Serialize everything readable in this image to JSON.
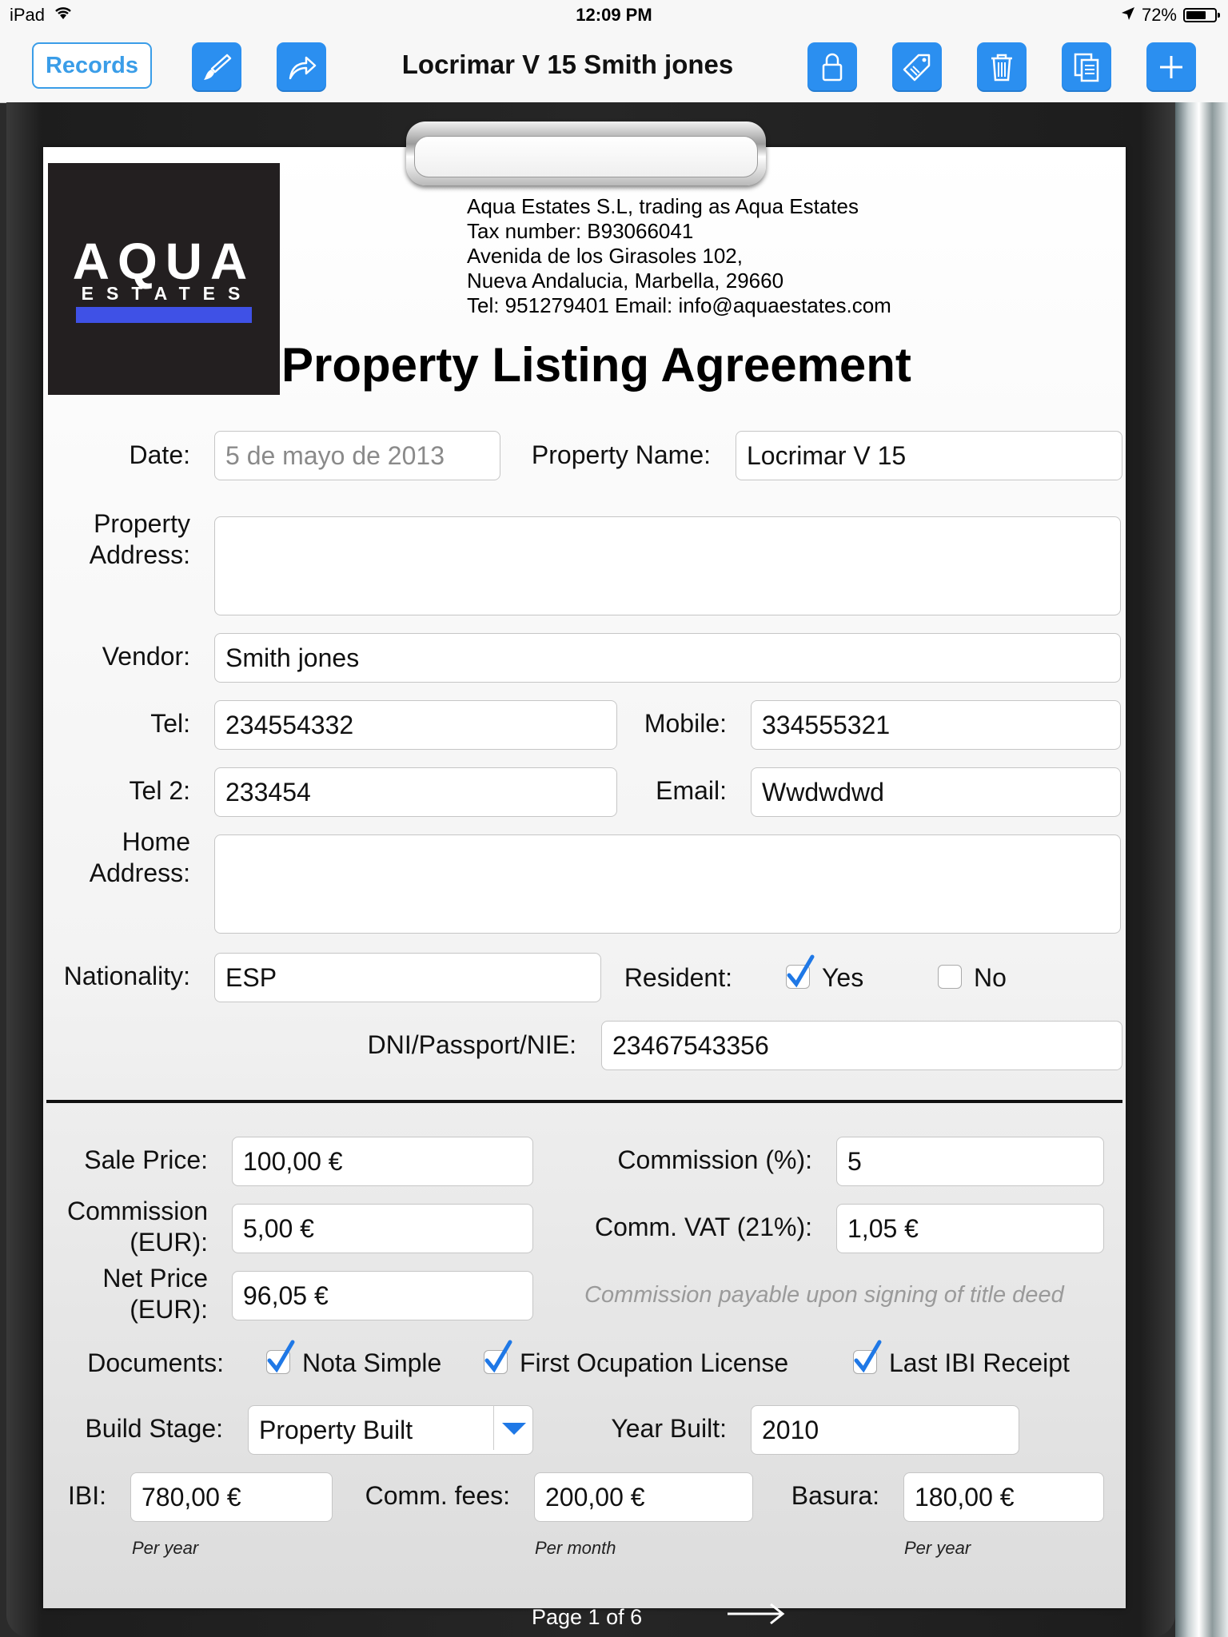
{
  "status_bar": {
    "device": "iPad",
    "time": "12:09 PM",
    "battery": "72%",
    "battery_level": 0.72
  },
  "toolbar": {
    "records_label": "Records",
    "title": "Locrimar V 15 Smith jones",
    "icons": [
      "brush-icon",
      "share-icon",
      "lock-icon",
      "tag-icon",
      "trash-icon",
      "copy-icon",
      "plus-icon"
    ]
  },
  "header": {
    "logo_line1": "AQUA",
    "logo_line2": "ESTATES",
    "logo_bar_color": "#3f51e6",
    "company_lines": [
      "Aqua Estates S.L, trading as Aqua Estates",
      "Tax number: B93066041",
      "Avenida de los Girasoles 102,",
      "Nueva Andalucia, Marbella, 29660",
      "Tel: 951279401 Email: info@aquaestates.com"
    ],
    "title": "Property Listing Agreement"
  },
  "form": {
    "date": {
      "label": "Date:",
      "value": "5 de mayo de 2013"
    },
    "property_name": {
      "label": "Property Name:",
      "value": "Locrimar V 15"
    },
    "property_address": {
      "label_1": "Property",
      "label_2": "Address:",
      "value": ""
    },
    "vendor": {
      "label": "Vendor:",
      "value": "Smith jones"
    },
    "tel": {
      "label": "Tel:",
      "value": "234554332"
    },
    "mobile": {
      "label": "Mobile:",
      "value": "334555321"
    },
    "tel2": {
      "label": "Tel 2:",
      "value": "233454"
    },
    "email": {
      "label": "Email:",
      "value": "Wwdwdwd"
    },
    "home_address": {
      "label_1": "Home",
      "label_2": "Address:",
      "value": ""
    },
    "nationality": {
      "label": "Nationality:",
      "value": "ESP"
    },
    "resident": {
      "label": "Resident:",
      "yes_label": "Yes",
      "no_label": "No",
      "yes_checked": true,
      "no_checked": false
    },
    "dni": {
      "label": "DNI/Passport/NIE:",
      "value": "23467543356"
    },
    "sale_price": {
      "label": "Sale Price:",
      "value": "100,00 €"
    },
    "commission_pct": {
      "label": "Commission (%):",
      "value": "5"
    },
    "commission_eur": {
      "label_1": "Commission",
      "label_2": "(EUR):",
      "value": "5,00 €"
    },
    "comm_vat": {
      "label": "Comm. VAT (21%):",
      "value": "1,05 €"
    },
    "net_price": {
      "label_1": "Net Price",
      "label_2": "(EUR):",
      "value": "96,05 €"
    },
    "commission_note": "Commission payable upon signing of title deed",
    "documents": {
      "label": "Documents:",
      "items": [
        {
          "label": "Nota Simple",
          "checked": true
        },
        {
          "label": "First Ocupation License",
          "checked": true
        },
        {
          "label": "Last IBI Receipt",
          "checked": true
        }
      ]
    },
    "build_stage": {
      "label": "Build Stage:",
      "value": "Property Built"
    },
    "year_built": {
      "label": "Year Built:",
      "value": "2010"
    },
    "ibi": {
      "label": "IBI:",
      "value": "780,00 €",
      "note": "Per year"
    },
    "comm_fees": {
      "label": "Comm. fees:",
      "value": "200,00 €",
      "note": "Per month"
    },
    "basura": {
      "label": "Basura:",
      "value": "180,00 €",
      "note": "Per year"
    }
  },
  "footer": {
    "page": "Page 1 of 6"
  },
  "colors": {
    "accent": "#2b8ff0",
    "check": "#1f78e6"
  }
}
